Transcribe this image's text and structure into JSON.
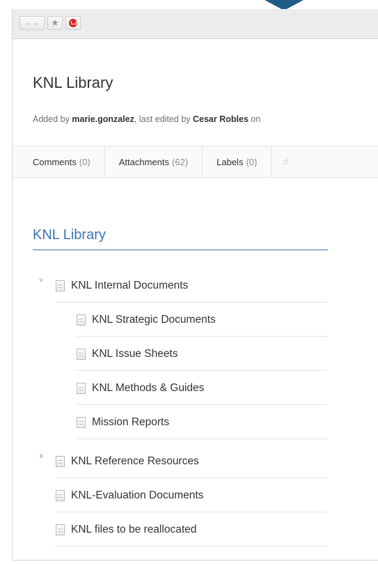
{
  "toolbar": {
    "nav_glyph": "←→",
    "star_glyph": "★",
    "icons": [
      "back-forward-icon",
      "star-icon",
      "mail-icon"
    ]
  },
  "page": {
    "title": "KNL Library",
    "byline": {
      "prefix": "Added by ",
      "author": "marie.gonzalez",
      "middle": ", last edited by ",
      "editor": "Cesar Robles",
      "suffix": " on"
    }
  },
  "tabs": [
    {
      "label": "Comments",
      "count": "(0)"
    },
    {
      "label": "Attachments",
      "count": "(62)"
    },
    {
      "label": "Labels",
      "count": "(0)"
    }
  ],
  "like_glyph": "☝",
  "library": {
    "heading": "KNL Library",
    "items": [
      {
        "label": "KNL Internal Documents",
        "expanded": true
      },
      {
        "label": "KNL Strategic Documents"
      },
      {
        "label": "KNL Issue Sheets"
      },
      {
        "label": "KNL Methods & Guides"
      },
      {
        "label": "Mission Reports"
      },
      {
        "label": "KNL Reference Resources",
        "expanded": false
      },
      {
        "label": "KNL-Evaluation Documents"
      },
      {
        "label": "KNL files to be reallocated"
      }
    ],
    "chevron_expanded": "˅",
    "chevron_collapsed": "›"
  },
  "colors": {
    "link_blue": "#3b73af",
    "mail_red": "#d6262a",
    "accent_navy": "#1f5d86"
  }
}
